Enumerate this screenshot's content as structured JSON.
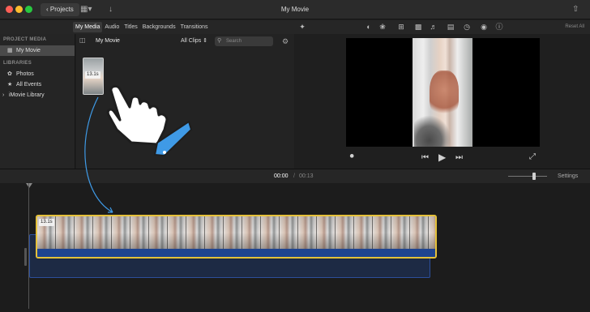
{
  "window": {
    "title": "My Movie"
  },
  "titlebar": {
    "projects_label": "Projects"
  },
  "tabs": [
    {
      "label": "My Media",
      "active": true
    },
    {
      "label": "Audio",
      "active": false
    },
    {
      "label": "Titles",
      "active": false
    },
    {
      "label": "Backgrounds",
      "active": false
    },
    {
      "label": "Transitions",
      "active": false
    }
  ],
  "viewer_tools": {
    "reset_label": "Reset All"
  },
  "sidebar": {
    "project_media_header": "PROJECT MEDIA",
    "project_item": "My Movie",
    "libraries_header": "LIBRARIES",
    "library_items": [
      {
        "label": "Photos",
        "icon": "photos-icon"
      },
      {
        "label": "All Events",
        "icon": "star-icon"
      },
      {
        "label": "iMovie Library",
        "icon": "disclosure-icon"
      }
    ]
  },
  "browser": {
    "title": "My Movie",
    "filter": "All Clips",
    "search_placeholder": "Search",
    "clip_duration": "13.1s"
  },
  "timeline": {
    "current_time": "00:00",
    "separator": "/",
    "total_time": "00:13",
    "settings_label": "Settings",
    "clip_duration": "13.1s"
  },
  "colors": {
    "accent_blue": "#3f9ae6",
    "clip_border": "#e5c13a",
    "audio_blue": "#1f4490"
  }
}
